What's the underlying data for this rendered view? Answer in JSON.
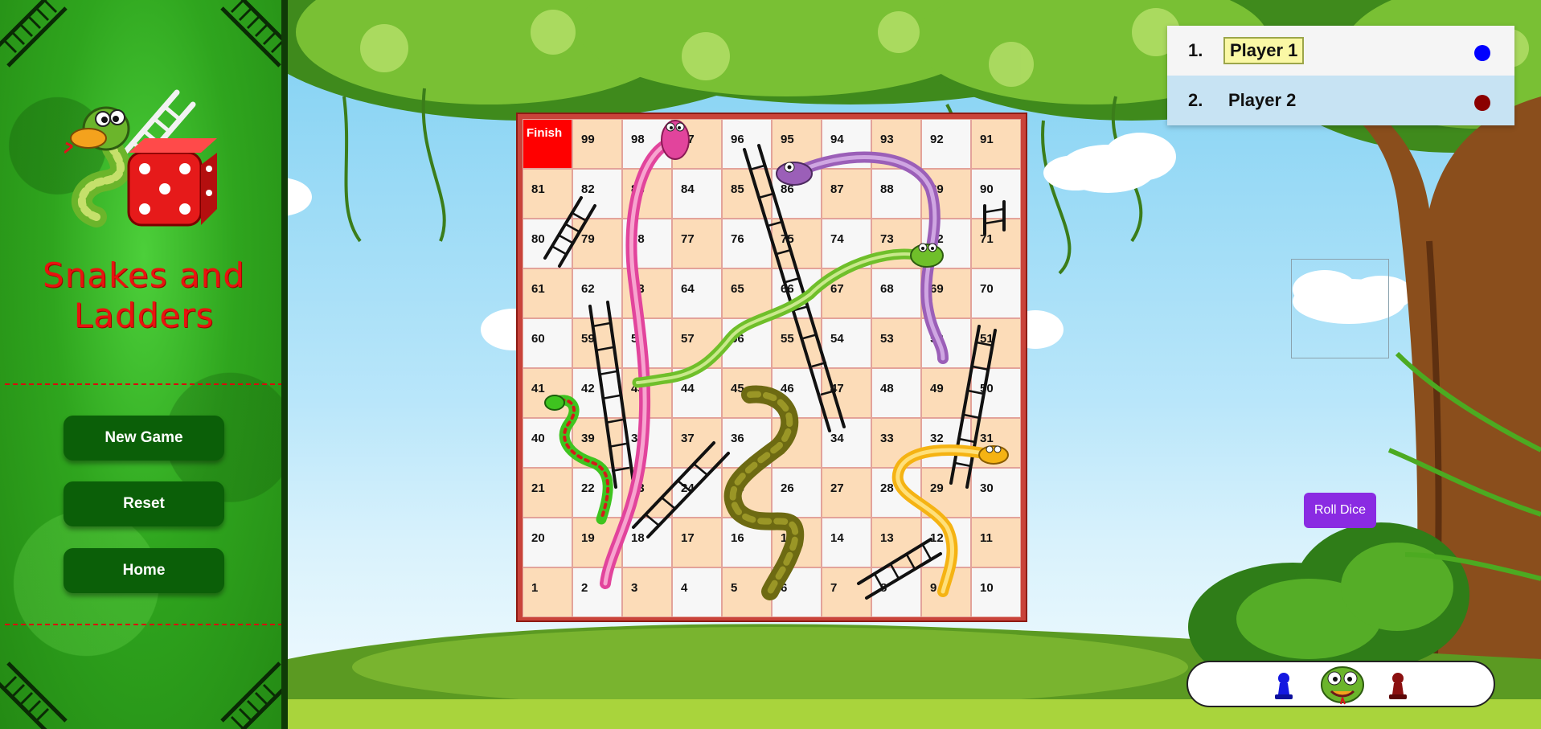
{
  "sidebar": {
    "title": "Snakes and Ladders",
    "buttons": {
      "new_game": "New Game",
      "reset": "Reset",
      "home": "Home"
    }
  },
  "board": {
    "finish_label": "Finish",
    "rows": [
      [
        "Finish",
        "99",
        "98",
        "97",
        "96",
        "95",
        "94",
        "93",
        "92",
        "91"
      ],
      [
        "81",
        "82",
        "83",
        "84",
        "85",
        "86",
        "87",
        "88",
        "89",
        "90"
      ],
      [
        "80",
        "79",
        "78",
        "77",
        "76",
        "75",
        "74",
        "73",
        "72",
        "71"
      ],
      [
        "61",
        "62",
        "63",
        "64",
        "65",
        "66",
        "67",
        "68",
        "69",
        "70"
      ],
      [
        "60",
        "59",
        "58",
        "57",
        "56",
        "55",
        "54",
        "53",
        "52",
        "51"
      ],
      [
        "41",
        "42",
        "43",
        "44",
        "45",
        "46",
        "47",
        "48",
        "49",
        "50"
      ],
      [
        "40",
        "39",
        "38",
        "37",
        "36",
        "35",
        "34",
        "33",
        "32",
        "31"
      ],
      [
        "21",
        "22",
        "23",
        "24",
        "25",
        "26",
        "27",
        "28",
        "29",
        "30"
      ],
      [
        "20",
        "19",
        "18",
        "17",
        "16",
        "15",
        "14",
        "13",
        "12",
        "11"
      ],
      [
        "1",
        "2",
        "3",
        "4",
        "5",
        "6",
        "7",
        "8",
        "9",
        "10"
      ]
    ],
    "colors": {
      "tan": "#fcdcb8",
      "light": "#f7f7f7",
      "finish": "#ff0000"
    }
  },
  "players": [
    {
      "number": "1.",
      "name": "Player 1",
      "color": "#0000ff",
      "active": true
    },
    {
      "number": "2.",
      "name": "Player 2",
      "color": "#8b0000",
      "active": false
    }
  ],
  "dice": {
    "roll_label": "Roll Dice"
  },
  "tray": {
    "tokens": [
      "blue-pawn-icon",
      "snake-mascot-icon",
      "red-pawn-icon"
    ]
  }
}
